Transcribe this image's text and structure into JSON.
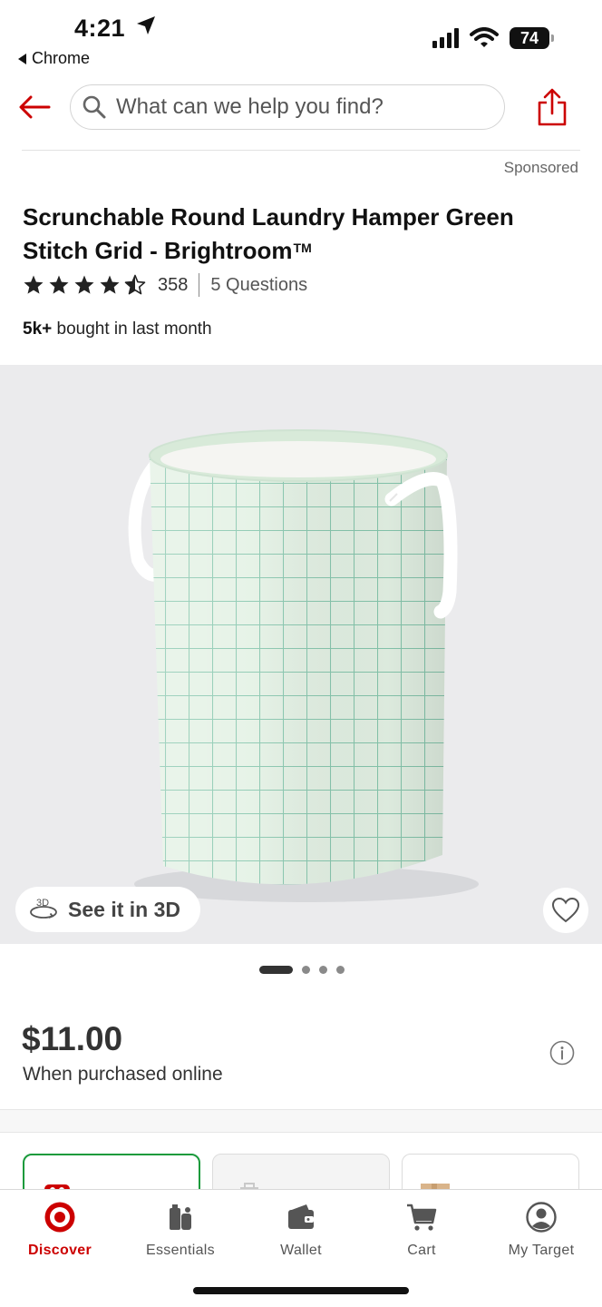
{
  "status_bar": {
    "time": "4:21",
    "back_app": "Chrome",
    "battery": "74"
  },
  "header": {
    "search_placeholder": "What can we help you find?"
  },
  "sponsored_label": "Sponsored",
  "product": {
    "title": "Scrunchable Round Laundry Hamper Green Stitch Grid - Brightroom",
    "trademark": "TM",
    "rating_value": 4.5,
    "rating_count": "358",
    "questions": "5 Questions",
    "bought_bold": "5k+",
    "bought_rest": " bought in last month",
    "see_3d_label": "See it in 3D",
    "image_count": 4,
    "image_active_index": 0,
    "price": "$11.00",
    "price_note": "When purchased online"
  },
  "colors": {
    "brand_red": "#cc0000",
    "selected_card_border": "#1a9a3c",
    "hamper_fabric": "#e3f1e4",
    "grid_stitch": "#7fc2a8"
  },
  "bottom_nav": [
    {
      "label": "Discover",
      "icon": "target-logo-icon",
      "active": true
    },
    {
      "label": "Essentials",
      "icon": "essentials-icon",
      "active": false
    },
    {
      "label": "Wallet",
      "icon": "wallet-icon",
      "active": false
    },
    {
      "label": "Cart",
      "icon": "cart-icon",
      "active": false
    },
    {
      "label": "My Target",
      "icon": "account-icon",
      "active": false
    }
  ]
}
